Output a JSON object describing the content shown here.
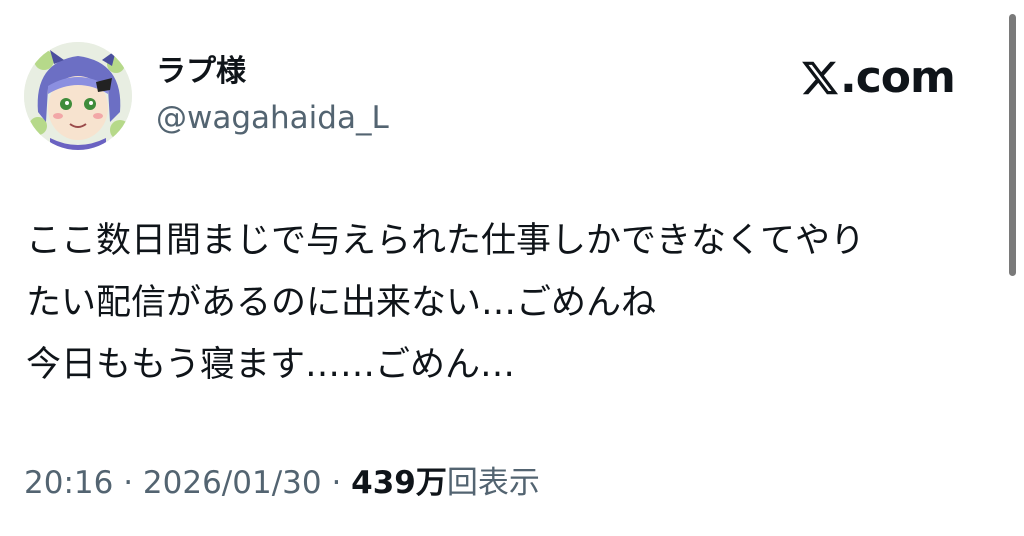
{
  "author": {
    "display_name": "ラプ様",
    "handle": "@wagahaida_L"
  },
  "brand": {
    "logo_icon": "x-logo-icon",
    "domain_suffix": ".com"
  },
  "tweet": {
    "lines": [
      "ここ数日間まじで与えられた仕事しかできなくてやり",
      "たい配信があるのに出来ない…ごめんね",
      "今日ももう寝ます……ごめん…"
    ]
  },
  "meta": {
    "time": "20:16",
    "separator": " · ",
    "date": "2026/01/30",
    "views_count": "439万",
    "views_label": "回表示"
  },
  "colors": {
    "text": "#0f1419",
    "secondary": "#536471",
    "background": "#ffffff"
  }
}
